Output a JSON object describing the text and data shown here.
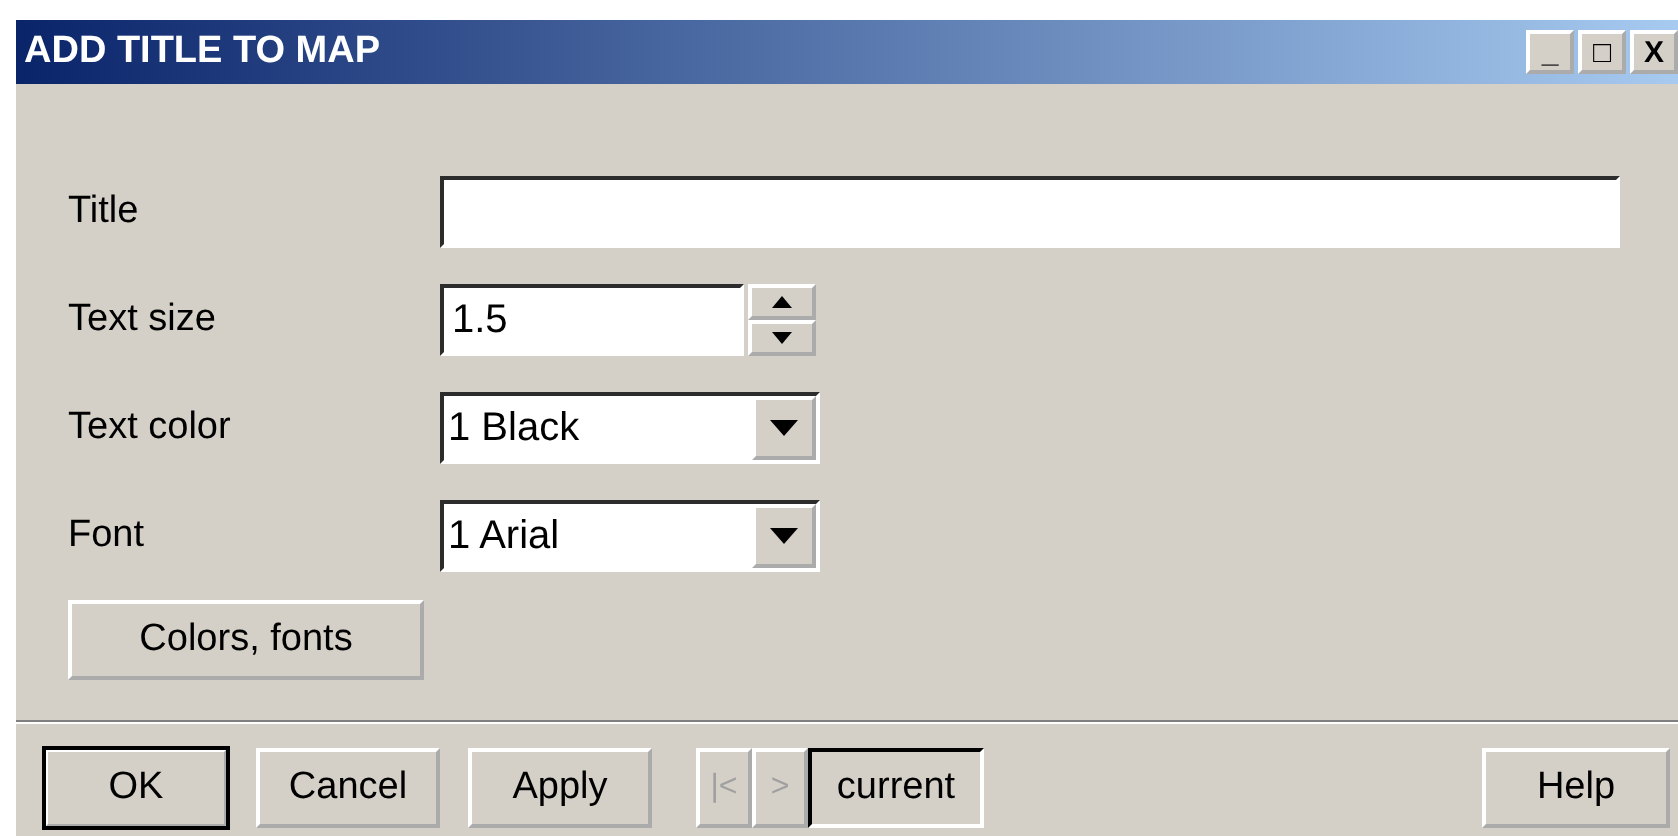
{
  "window": {
    "title": "ADD TITLE TO MAP",
    "controls": [
      "_",
      "□",
      "X"
    ]
  },
  "fields": [
    {
      "label": "Title",
      "kind": "text"
    },
    {
      "label": "Text size",
      "kind": "spin",
      "value": "1.5"
    },
    {
      "label": "Text color",
      "kind": "select",
      "value": "1 Black"
    },
    {
      "label": "Font",
      "kind": "select",
      "value": "1 Arial"
    }
  ],
  "colors_button": "Colors, fonts",
  "buttons": [
    {
      "label": "OK",
      "default": true
    },
    {
      "label": "Cancel",
      "default": false
    },
    {
      "label": "Apply",
      "default": false
    }
  ],
  "nav": {
    "first": "|<",
    "next": ">",
    "disabled": true,
    "current": "current"
  },
  "help": "Help"
}
